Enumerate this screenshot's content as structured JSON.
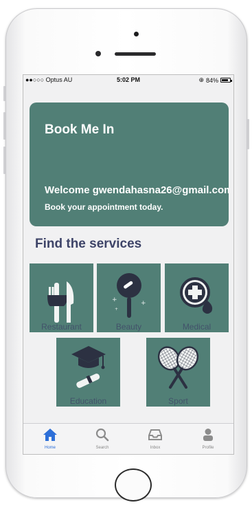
{
  "status": {
    "carrier": "●●○○○ Optus AU",
    "time": "5:02 PM",
    "battery": "84%",
    "battery_level": 0.84
  },
  "hero": {
    "title": "Book Me In",
    "welcome": "Welcome gwendahasna26@gmail.com",
    "subtitle": "Book your appointment today."
  },
  "services": {
    "heading": "Find the services",
    "items": [
      {
        "label": "Restaurant",
        "icon": "utensils-icon"
      },
      {
        "label": "Beauty",
        "icon": "mirror-icon"
      },
      {
        "label": "Medical",
        "icon": "medical-cross-icon"
      },
      {
        "label": "Education",
        "icon": "graduation-cap-icon"
      },
      {
        "label": "Sport",
        "icon": "tennis-rackets-icon"
      }
    ]
  },
  "tabbar": {
    "items": [
      {
        "label": "Home",
        "icon": "home-icon",
        "active": true
      },
      {
        "label": "Search",
        "icon": "search-icon",
        "active": false
      },
      {
        "label": "Inbox",
        "icon": "inbox-icon",
        "active": false
      },
      {
        "label": "Profile",
        "icon": "profile-icon",
        "active": false
      }
    ]
  },
  "colors": {
    "accent": "#517f76",
    "heading": "#3e4468",
    "tab_active": "#2d6fd8",
    "screen_bg": "#f1f1f2"
  }
}
